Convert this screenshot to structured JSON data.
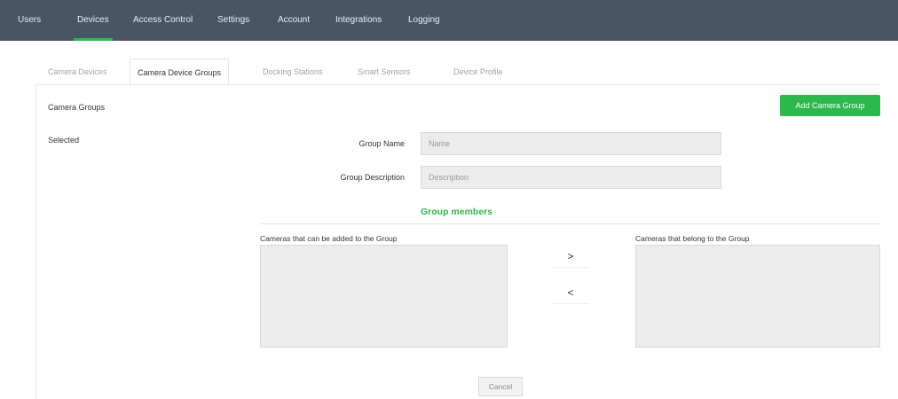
{
  "topnav": {
    "items": [
      {
        "label": "Users"
      },
      {
        "label": "Devices"
      },
      {
        "label": "Access Control"
      },
      {
        "label": "Settings"
      },
      {
        "label": "Account"
      },
      {
        "label": "Integrations"
      },
      {
        "label": "Logging"
      }
    ],
    "active_item": "Devices",
    "accent_color": "#2db84d",
    "background_color": "#4a5564"
  },
  "subtabs": {
    "items": [
      {
        "label": "Camera Devices"
      },
      {
        "label": "Camera Device Groups"
      },
      {
        "label": "Docking Stations"
      },
      {
        "label": "Smart Sensors"
      },
      {
        "label": "Device Profile"
      }
    ],
    "active_item": "Camera Device Groups"
  },
  "sidebar": {
    "title": "Camera Groups",
    "items": [
      {
        "label": "Selected"
      }
    ]
  },
  "add_button": {
    "label": "Add Camera Group",
    "color": "#2db84d"
  },
  "form": {
    "group_name": {
      "label": "Group Name",
      "placeholder": "Name",
      "value": ""
    },
    "group_description": {
      "label": "Group Description",
      "placeholder": "Description",
      "value": ""
    }
  },
  "members": {
    "title": "Group members",
    "available_label": "Cameras that can be added to the Group",
    "assigned_label": "Cameras that belong to the Group",
    "move_right_label": ">",
    "move_left_label": "<"
  },
  "cancel_button": {
    "label": "Cancel"
  }
}
